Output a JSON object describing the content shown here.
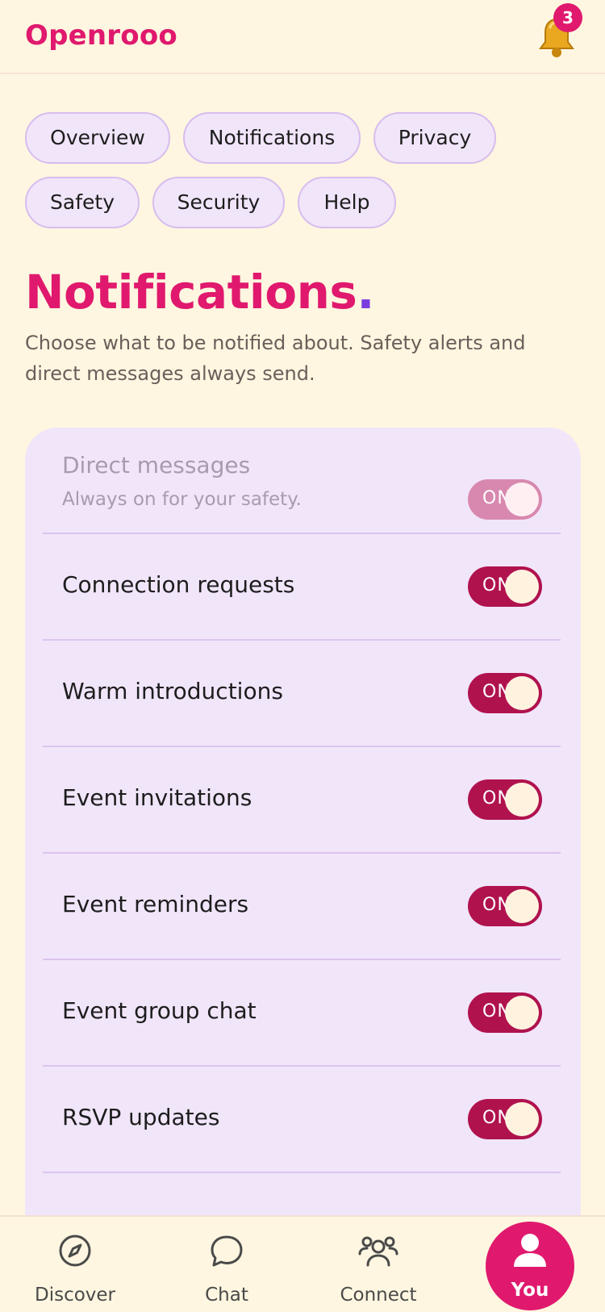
{
  "app": {
    "brand": "Openrooo",
    "notification_count": "3"
  },
  "tabs": [
    {
      "label": "Overview"
    },
    {
      "label": "Notifications"
    },
    {
      "label": "Privacy"
    },
    {
      "label": "Safety"
    },
    {
      "label": "Security"
    },
    {
      "label": "Help"
    }
  ],
  "page": {
    "title": "Notifications",
    "title_dot": ".",
    "subtitle": "Choose what to be notified about. Safety alerts and direct messages always send."
  },
  "settings": [
    {
      "label": "Direct messages",
      "sub": "Always on for your safety.",
      "toggle": "ON",
      "enabled": true,
      "locked": true
    },
    {
      "label": "Connection requests",
      "toggle": "ON",
      "enabled": true,
      "locked": false
    },
    {
      "label": "Warm introductions",
      "toggle": "ON",
      "enabled": true,
      "locked": false
    },
    {
      "label": "Event invitations",
      "toggle": "ON",
      "enabled": true,
      "locked": false
    },
    {
      "label": "Event reminders",
      "toggle": "ON",
      "enabled": true,
      "locked": false
    },
    {
      "label": "Event group chat",
      "toggle": "ON",
      "enabled": true,
      "locked": false
    },
    {
      "label": "RSVP updates",
      "toggle": "ON",
      "enabled": true,
      "locked": false
    }
  ],
  "bottom_nav": [
    {
      "label": "Discover",
      "icon": "compass-icon"
    },
    {
      "label": "Chat",
      "icon": "chat-bubble-icon"
    },
    {
      "label": "Connect",
      "icon": "people-icon"
    },
    {
      "label": "You",
      "icon": "user-icon",
      "active": true
    }
  ],
  "colors": {
    "background": "#FEF6E0",
    "brand": "#E0196E",
    "accent_purple": "#7A3DE0",
    "card": "#F1E5FA",
    "toggle_on": "#B0124E",
    "toggle_locked": "#D888AE"
  }
}
